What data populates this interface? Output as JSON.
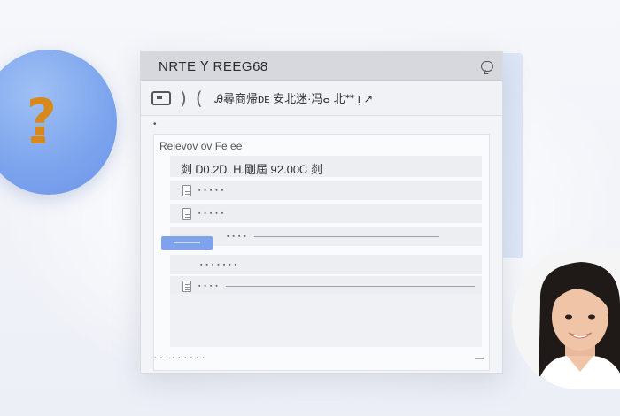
{
  "window": {
    "title": "NRTE ꓬ REEG68"
  },
  "toolbar": {
    "text": "Ꭿ尋商帰ᴅᴇ 安北迷·冯ⴰ 北ᕯ ᴉ ↗"
  },
  "panel": {
    "title": "Reievov ov Fe ee",
    "summary": "剡 Ꭰ0.2Ꭰ. Ꮋ.剛屆  92.00Ꮯ 剡",
    "rows": [
      {
        "text": "▪ ▪ ▪ ▪ ▪"
      },
      {
        "text": "▪ ▪ ▪ ▪ ▪"
      },
      {
        "text": "▪ ▪ ▪ ▪"
      },
      {
        "text": "▪ ▪ ▪ ▪ ▪ ▪ ▪"
      },
      {
        "text": "▪ ▪ ▪ ▪"
      }
    ],
    "footer": "▪ ▪ ▪ ▪ ▪ ▪ ▪ ▪ ▪"
  },
  "icons": {
    "help": "question-mark",
    "chat": "chat-bubble"
  },
  "colors": {
    "accent": "#7ea2ec",
    "help_circle": "#7ea6ee",
    "help_glyph": "#d7891c"
  }
}
